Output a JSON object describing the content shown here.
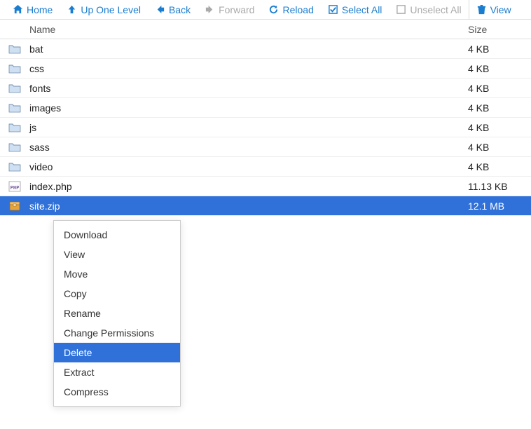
{
  "toolbar": {
    "home": "Home",
    "up": "Up One Level",
    "back": "Back",
    "forward": "Forward",
    "reload": "Reload",
    "select_all": "Select All",
    "unselect_all": "Unselect All",
    "view": "View"
  },
  "headers": {
    "name": "Name",
    "size": "Size"
  },
  "files": [
    {
      "name": "bat",
      "size": "4 KB",
      "type": "folder",
      "selected": false
    },
    {
      "name": "css",
      "size": "4 KB",
      "type": "folder",
      "selected": false
    },
    {
      "name": "fonts",
      "size": "4 KB",
      "type": "folder",
      "selected": false
    },
    {
      "name": "images",
      "size": "4 KB",
      "type": "folder",
      "selected": false
    },
    {
      "name": "js",
      "size": "4 KB",
      "type": "folder",
      "selected": false
    },
    {
      "name": "sass",
      "size": "4 KB",
      "type": "folder",
      "selected": false
    },
    {
      "name": "video",
      "size": "4 KB",
      "type": "folder",
      "selected": false
    },
    {
      "name": "index.php",
      "size": "11.13 KB",
      "type": "php",
      "selected": false
    },
    {
      "name": "site.zip",
      "size": "12.1 MB",
      "type": "zip",
      "selected": true
    }
  ],
  "context_menu": [
    {
      "label": "Download",
      "active": false
    },
    {
      "label": "View",
      "active": false
    },
    {
      "label": "Move",
      "active": false
    },
    {
      "label": "Copy",
      "active": false
    },
    {
      "label": "Rename",
      "active": false
    },
    {
      "label": "Change Permissions",
      "active": false
    },
    {
      "label": "Delete",
      "active": true
    },
    {
      "label": "Extract",
      "active": false
    },
    {
      "label": "Compress",
      "active": false
    }
  ]
}
